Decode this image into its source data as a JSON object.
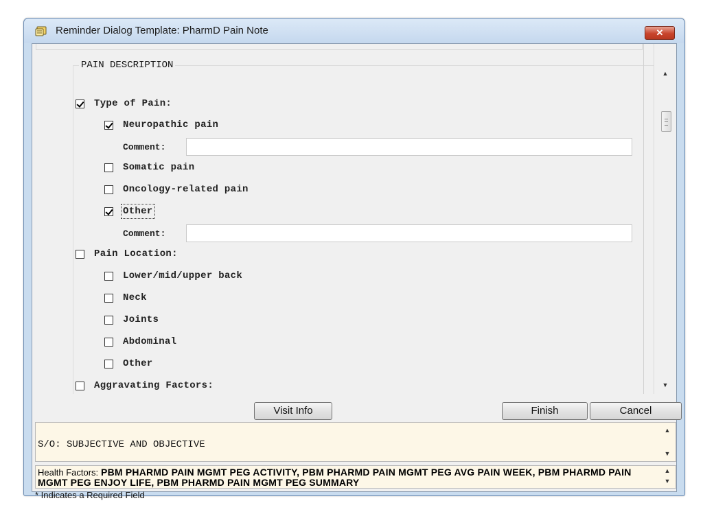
{
  "window": {
    "title": "Reminder Dialog Template: PharmD Pain Note",
    "close_glyph": "✕"
  },
  "section": {
    "caption": "PAIN DESCRIPTION"
  },
  "items": [
    {
      "label": "Type of Pain:",
      "checked": true
    },
    {
      "label": "Neuropathic pain",
      "checked": true
    },
    {
      "label": "Somatic pain",
      "checked": false
    },
    {
      "label": "Oncology-related pain",
      "checked": false
    },
    {
      "label": "Other",
      "checked": true
    },
    {
      "label": "Pain Location:",
      "checked": false
    },
    {
      "label": "Lower/mid/upper back",
      "checked": false
    },
    {
      "label": "Neck",
      "checked": false
    },
    {
      "label": "Joints",
      "checked": false
    },
    {
      "label": "Abdominal",
      "checked": false
    },
    {
      "label": "Other",
      "checked": false
    },
    {
      "label": "Aggravating Factors:",
      "checked": false
    }
  ],
  "comments": [
    {
      "label": "Comment:",
      "value": ""
    },
    {
      "label": "Comment:",
      "value": ""
    }
  ],
  "buttons": {
    "visit_info": "Visit Info",
    "finish": "Finish",
    "cancel": "Cancel"
  },
  "preview": {
    "text": "S/O: SUBJECTIVE AND OBJECTIVE"
  },
  "health_factors": {
    "label": "Health Factors:",
    "value": "PBM PHARMD PAIN MGMT PEG ACTIVITY, PBM PHARMD PAIN MGMT PEG AVG PAIN WEEK, PBM PHARMD PAIN MGMT PEG ENJOY LIFE, PBM PHARMD PAIN MGMT PEG SUMMARY"
  },
  "status": {
    "text": "* Indicates a Required Field"
  },
  "icons": {
    "up": "▲",
    "down": "▼"
  },
  "colors": {
    "preview_background": "#fdf7e7",
    "close_button": "#c8452d",
    "title_bar": "#c9dcef"
  }
}
